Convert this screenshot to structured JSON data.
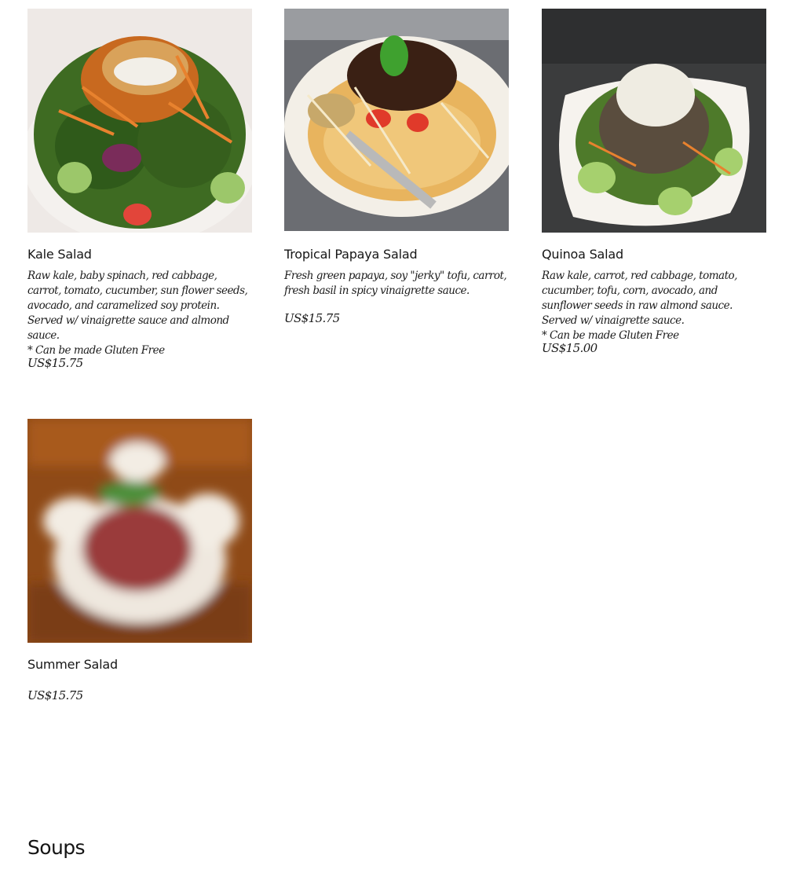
{
  "menu_items": [
    {
      "name": "Kale Salad",
      "description": "Raw kale, baby spinach, red cabbage, carrot, tomato, cucumber, sun flower seeds, avocado, and caramelized soy protein. Served w/ vinaigrette sauce and almond sauce.\n* Can be made Gluten Free",
      "price": "US$15.75"
    },
    {
      "name": "Tropical Papaya Salad",
      "description": "Fresh green papaya, soy \"jerky\" tofu, carrot, fresh basil in spicy vinaigrette sauce.",
      "price": "US$15.75"
    },
    {
      "name": "Quinoa Salad",
      "description": "Raw kale, carrot, red cabbage, tomato, cucumber, tofu, corn, avocado, and sunflower seeds in raw almond sauce. Served w/ vinaigrette sauce.\n* Can be made Gluten Free",
      "price": "US$15.00"
    },
    {
      "name": "Summer Salad",
      "description": "",
      "price": "US$15.75"
    }
  ],
  "section": {
    "title": "Soups"
  }
}
